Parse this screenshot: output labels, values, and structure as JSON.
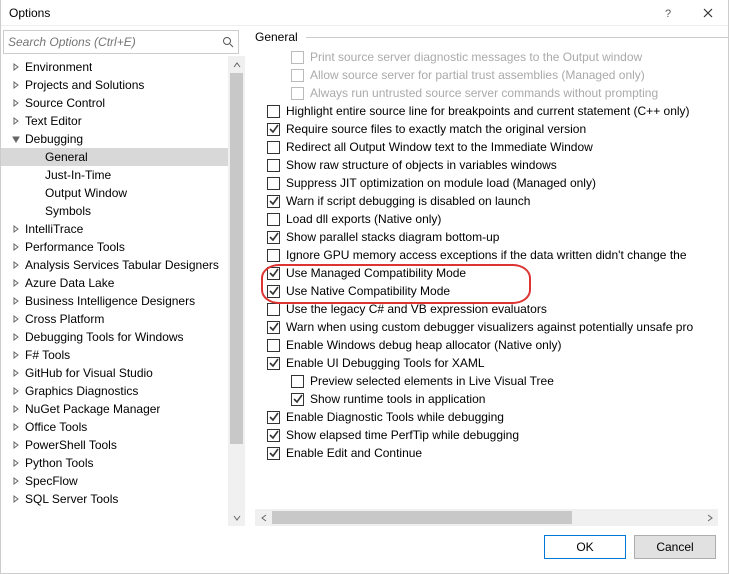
{
  "window": {
    "title": "Options"
  },
  "search": {
    "placeholder": "Search Options (Ctrl+E)"
  },
  "tree": [
    {
      "label": "Environment",
      "depth": 0,
      "expander": "collapsed"
    },
    {
      "label": "Projects and Solutions",
      "depth": 0,
      "expander": "collapsed"
    },
    {
      "label": "Source Control",
      "depth": 0,
      "expander": "collapsed"
    },
    {
      "label": "Text Editor",
      "depth": 0,
      "expander": "collapsed"
    },
    {
      "label": "Debugging",
      "depth": 0,
      "expander": "expanded"
    },
    {
      "label": "General",
      "depth": 1,
      "expander": "none",
      "selected": true
    },
    {
      "label": "Just-In-Time",
      "depth": 1,
      "expander": "none"
    },
    {
      "label": "Output Window",
      "depth": 1,
      "expander": "none"
    },
    {
      "label": "Symbols",
      "depth": 1,
      "expander": "none"
    },
    {
      "label": "IntelliTrace",
      "depth": 0,
      "expander": "collapsed"
    },
    {
      "label": "Performance Tools",
      "depth": 0,
      "expander": "collapsed"
    },
    {
      "label": "Analysis Services Tabular Designers",
      "depth": 0,
      "expander": "collapsed"
    },
    {
      "label": "Azure Data Lake",
      "depth": 0,
      "expander": "collapsed"
    },
    {
      "label": "Business Intelligence Designers",
      "depth": 0,
      "expander": "collapsed"
    },
    {
      "label": "Cross Platform",
      "depth": 0,
      "expander": "collapsed"
    },
    {
      "label": "Debugging Tools for Windows",
      "depth": 0,
      "expander": "collapsed"
    },
    {
      "label": "F# Tools",
      "depth": 0,
      "expander": "collapsed"
    },
    {
      "label": "GitHub for Visual Studio",
      "depth": 0,
      "expander": "collapsed"
    },
    {
      "label": "Graphics Diagnostics",
      "depth": 0,
      "expander": "collapsed"
    },
    {
      "label": "NuGet Package Manager",
      "depth": 0,
      "expander": "collapsed"
    },
    {
      "label": "Office Tools",
      "depth": 0,
      "expander": "collapsed"
    },
    {
      "label": "PowerShell Tools",
      "depth": 0,
      "expander": "collapsed"
    },
    {
      "label": "Python Tools",
      "depth": 0,
      "expander": "collapsed"
    },
    {
      "label": "SpecFlow",
      "depth": 0,
      "expander": "collapsed"
    },
    {
      "label": "SQL Server Tools",
      "depth": 0,
      "expander": "collapsed"
    }
  ],
  "section_title": "General",
  "options": [
    {
      "label": "Print source server diagnostic messages to the Output window",
      "checked": false,
      "indent": 1,
      "disabled": true
    },
    {
      "label": "Allow source server for partial trust assemblies (Managed only)",
      "checked": false,
      "indent": 1,
      "disabled": true
    },
    {
      "label": "Always run untrusted source server commands without prompting",
      "checked": false,
      "indent": 1,
      "disabled": true
    },
    {
      "label": "Highlight entire source line for breakpoints and current statement (C++ only)",
      "checked": false,
      "indent": 0
    },
    {
      "label": "Require source files to exactly match the original version",
      "checked": true,
      "indent": 0
    },
    {
      "label": "Redirect all Output Window text to the Immediate Window",
      "checked": false,
      "indent": 0
    },
    {
      "label": "Show raw structure of objects in variables windows",
      "checked": false,
      "indent": 0
    },
    {
      "label": "Suppress JIT optimization on module load (Managed only)",
      "checked": false,
      "indent": 0
    },
    {
      "label": "Warn if script debugging is disabled on launch",
      "checked": true,
      "indent": 0
    },
    {
      "label": "Load dll exports (Native only)",
      "checked": false,
      "indent": 0
    },
    {
      "label": "Show parallel stacks diagram bottom-up",
      "checked": true,
      "indent": 0
    },
    {
      "label": "Ignore GPU memory access exceptions if the data written didn't change the",
      "checked": false,
      "indent": 0
    },
    {
      "label": "Use Managed Compatibility Mode",
      "checked": true,
      "indent": 0
    },
    {
      "label": "Use Native Compatibility Mode",
      "checked": true,
      "indent": 0
    },
    {
      "label": "Use the legacy C# and VB expression evaluators",
      "checked": false,
      "indent": 0
    },
    {
      "label": "Warn when using custom debugger visualizers against potentially unsafe pro",
      "checked": true,
      "indent": 0
    },
    {
      "label": "Enable Windows debug heap allocator (Native only)",
      "checked": false,
      "indent": 0
    },
    {
      "label": "Enable UI Debugging Tools for XAML",
      "checked": true,
      "indent": 0
    },
    {
      "label": "Preview selected elements in Live Visual Tree",
      "checked": false,
      "indent": 1
    },
    {
      "label": "Show runtime tools in application",
      "checked": true,
      "indent": 1
    },
    {
      "label": "Enable Diagnostic Tools while debugging",
      "checked": true,
      "indent": 0
    },
    {
      "label": "Show elapsed time PerfTip while debugging",
      "checked": true,
      "indent": 0
    },
    {
      "label": "Enable Edit and Continue",
      "checked": true,
      "indent": 0
    }
  ],
  "buttons": {
    "ok": "OK",
    "cancel": "Cancel"
  }
}
